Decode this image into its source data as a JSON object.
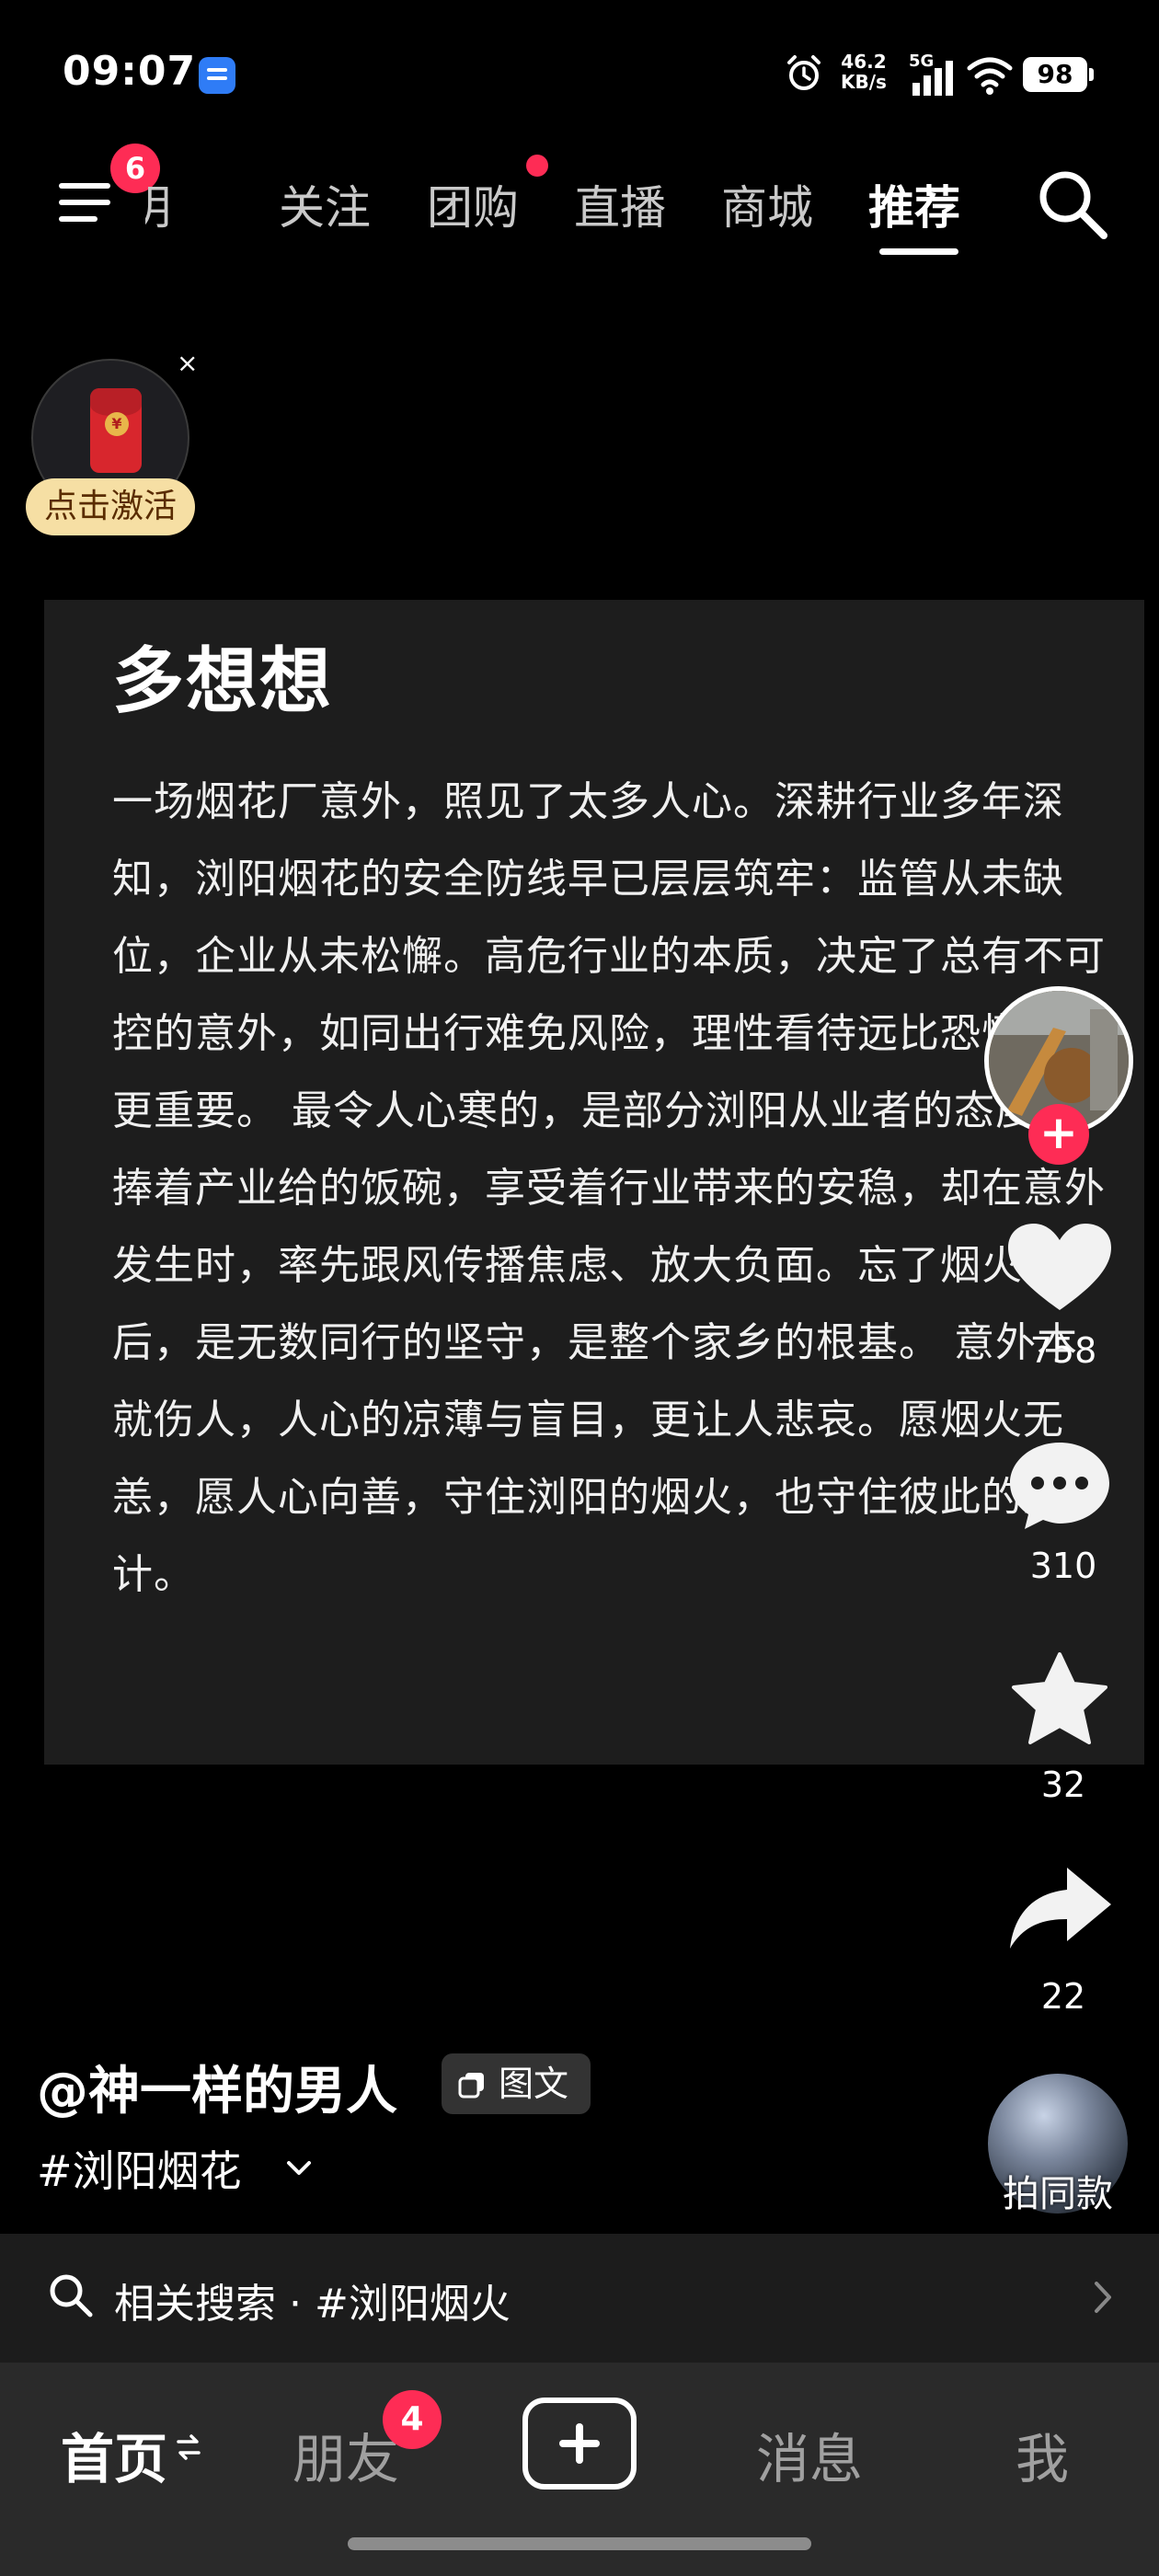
{
  "status_bar": {
    "time": "09:07",
    "net_speed_value": "46.2",
    "net_speed_unit": "KB/s",
    "network": "5G",
    "battery": "98",
    "icons": [
      "app-notification-icon",
      "alarm-icon",
      "signal-bars-icon",
      "wifi-icon",
      "battery-icon"
    ]
  },
  "top_nav": {
    "menu_badge": "6",
    "tabs": [
      "明",
      "关注",
      "团购",
      "直播",
      "商城",
      "推荐"
    ],
    "active_tab": "推荐"
  },
  "red_packet": {
    "coin_symbol": "¥",
    "close": "×",
    "label": "点击激活"
  },
  "post": {
    "title": "多想想",
    "body": "一场烟花厂意外，照见了太多人心。深耕行业多年深知，浏阳烟花的安全防线早已层层筑牢：监管从未缺位，企业从未松懈。高危行业的本质，决定了总有不可控的意外，如同出行难免风险，理性看待远比恐慌起哄更重要。 最令人心寒的，是部分浏阳从业者的态度。捧着产业给的饭碗，享受着行业带来的安稳，却在意外发生时，率先跟风传播焦虑、放大负面。忘了烟火背后，是无数同行的坚守，是整个家乡的根基。 意外本就伤人，人心的凉薄与盲目，更让人悲哀。愿烟火无恙，愿人心向善，守住浏阳的烟火，也守住彼此的生计。"
  },
  "actions": {
    "follow_plus": "+",
    "like_count": "758",
    "comment_count": "310",
    "favorite_count": "32",
    "share_count": "22"
  },
  "author": {
    "name": "@神一样的男人",
    "type_badge": "图文",
    "hashtag": "#浏阳烟花",
    "make_same": "拍同款"
  },
  "related_search": {
    "label": "相关搜索 · #浏阳烟火"
  },
  "bottom_nav": {
    "home": "首页",
    "friends": "朋友",
    "friends_badge": "4",
    "messages": "消息",
    "me": "我"
  },
  "colors": {
    "accent": "#fe2c55",
    "card_bg": "#1d1d1d",
    "nav_bg": "#2a2a2a"
  }
}
